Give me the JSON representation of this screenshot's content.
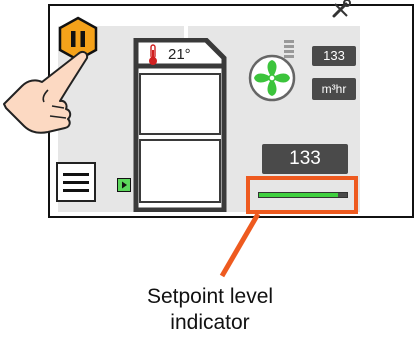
{
  "thermostat": {
    "temperature": "21°",
    "flow_value": "133",
    "flow_unit": "m³hr",
    "setpoint_value": "133",
    "setpoint_level": 0.9
  },
  "icons": {
    "pause": "pause-icon",
    "wrench": "wrench-icon",
    "menu": "hamburger-menu-icon",
    "fan": "fan-icon",
    "thermometer": "thermometer-icon",
    "play": "play-icon",
    "hand": "pointing-hand-icon"
  },
  "colors": {
    "pause_button": "#f5a21a",
    "highlight": "#ee5a1f",
    "level_fill": "#3fcf3f",
    "fan_green": "#3cc43c"
  },
  "caption": {
    "line1": "Setpoint level",
    "line2": "indicator"
  }
}
